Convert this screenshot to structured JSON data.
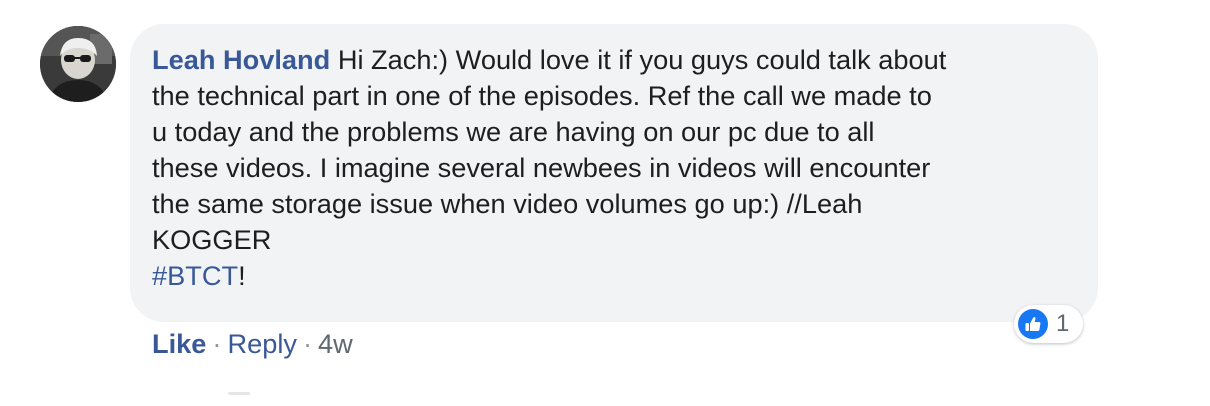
{
  "comment": {
    "author": "Leah Hovland",
    "lines": [
      " Hi Zach:) Would love it if you guys could talk about",
      "the technical part in one of the episodes. Ref the call we made to",
      "u today and the problems we are having on our pc due to all",
      "these videos. I imagine several newbees in videos will encounter",
      "the same storage issue when video volumes go up:) //Leah",
      "KOGGER"
    ],
    "hashtag": "#BTCT",
    "hashtag_suffix": "!"
  },
  "reaction": {
    "icon": "thumbs-up-icon",
    "count": "1",
    "color": "#1877f2"
  },
  "actions": {
    "like": "Like",
    "reply": "Reply",
    "separator": "·",
    "time": "4w"
  },
  "colors": {
    "link": "#385898",
    "bubble": "#f2f3f5",
    "text": "#1c1e21",
    "meta": "#606770"
  }
}
